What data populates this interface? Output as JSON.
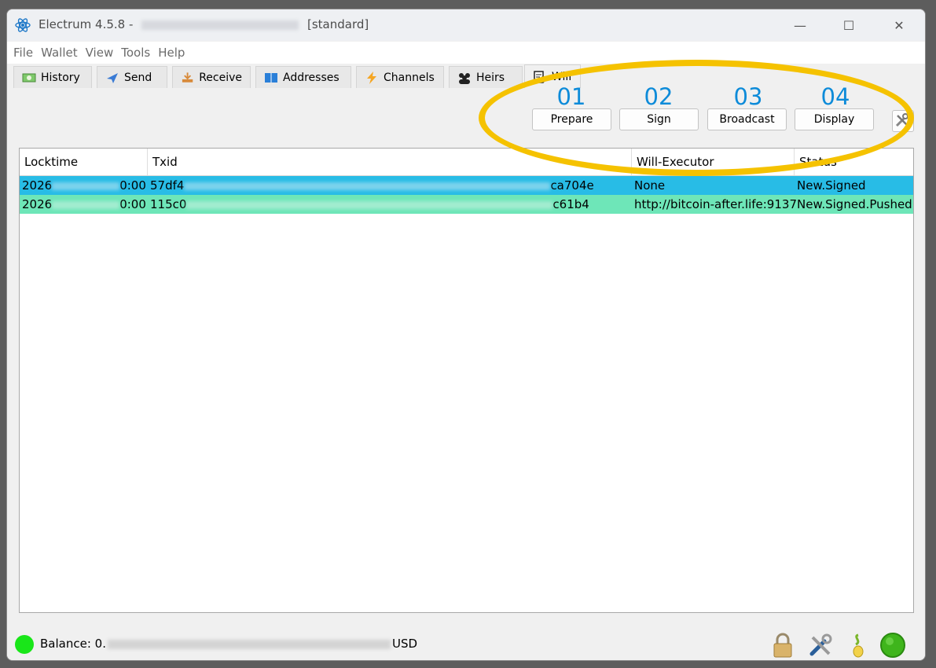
{
  "window": {
    "app_title": "Electrum 4.5.8",
    "separator": "-",
    "wallet_type": "[standard]",
    "controls": {
      "minimize": "—",
      "maximize": "☐",
      "close": "✕"
    }
  },
  "menu": [
    "File",
    "Wallet",
    "View",
    "Tools",
    "Help"
  ],
  "tabs": [
    {
      "label": "History",
      "icon": "history-icon"
    },
    {
      "label": "Send",
      "icon": "send-icon"
    },
    {
      "label": "Receive",
      "icon": "receive-icon"
    },
    {
      "label": "Addresses",
      "icon": "addresses-icon"
    },
    {
      "label": "Channels",
      "icon": "lightning-icon"
    },
    {
      "label": "Heirs",
      "icon": "heirs-icon"
    },
    {
      "label": "Will",
      "icon": "will-icon",
      "active": true
    }
  ],
  "will_actions": [
    {
      "step": "01",
      "label": "Prepare"
    },
    {
      "step": "02",
      "label": "Sign"
    },
    {
      "step": "03",
      "label": "Broadcast"
    },
    {
      "step": "04",
      "label": "Display"
    }
  ],
  "table": {
    "columns": [
      "Locktime",
      "Txid",
      "Will-Executor",
      "Status"
    ],
    "rows": [
      {
        "locktime_start": "2026",
        "locktime_end": "0:00",
        "txid_start": "57df4",
        "txid_end": "ca704e",
        "executor": "None",
        "status": "New.Signed",
        "color": "#28bce6"
      },
      {
        "locktime_start": "2026",
        "locktime_end": "0:00",
        "txid_start": "115c0",
        "txid_end": "c61b4",
        "executor": "http://bitcoin-after.life:9137",
        "status": "New.Signed.Pushed",
        "color": "#6ee6b8"
      }
    ]
  },
  "status_bar": {
    "balance_prefix": "Balance: 0.",
    "balance_suffix": "USD",
    "network_status_color": "#19e619"
  },
  "colors": {
    "accent_number": "#0d8bd9",
    "annotation_ellipse": "#f5c200"
  }
}
